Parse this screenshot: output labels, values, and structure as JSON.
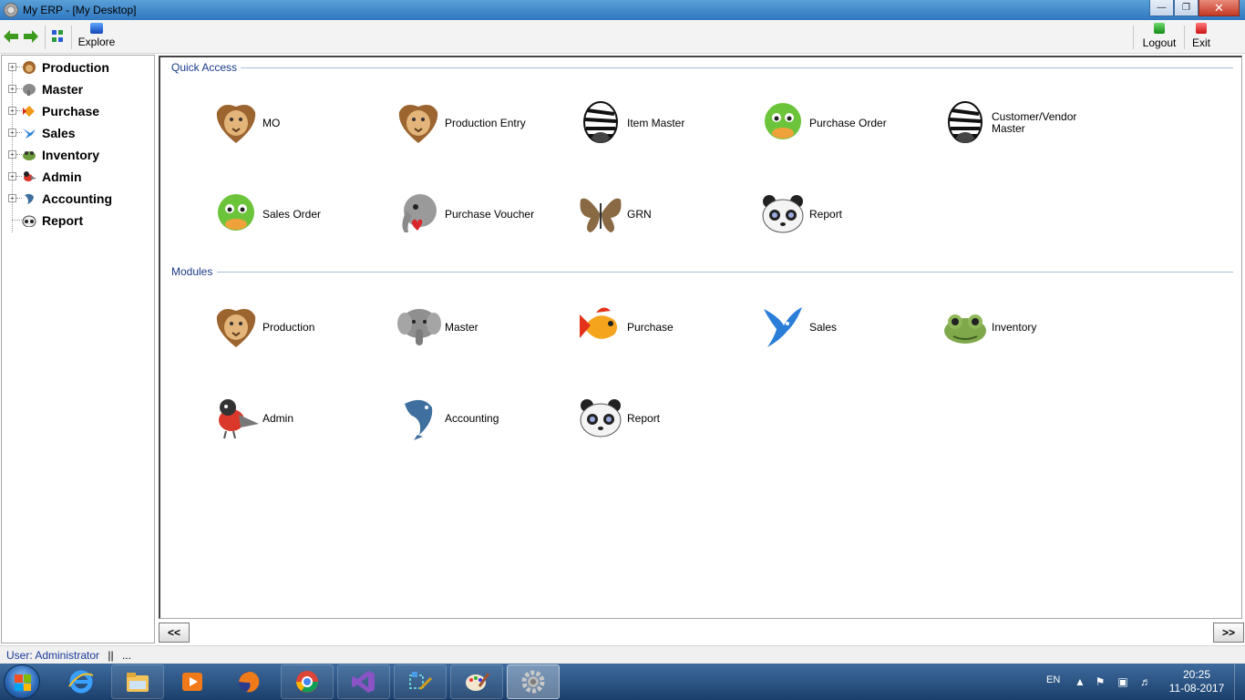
{
  "window": {
    "title": "My ERP - [My Desktop]"
  },
  "toolbar": {
    "explore_label": "Explore",
    "logout_label": "Logout",
    "exit_label": "Exit"
  },
  "sidebar": {
    "items": [
      {
        "label": "Production",
        "icon": "lion-icon"
      },
      {
        "label": "Master",
        "icon": "elephant-icon"
      },
      {
        "label": "Purchase",
        "icon": "fish-icon"
      },
      {
        "label": "Sales",
        "icon": "bird-icon"
      },
      {
        "label": "Inventory",
        "icon": "frog-icon"
      },
      {
        "label": "Admin",
        "icon": "bullfinch-icon"
      },
      {
        "label": "Accounting",
        "icon": "dolphin-icon"
      },
      {
        "label": "Report",
        "icon": "panda-icon"
      }
    ]
  },
  "quick_access": {
    "title": "Quick Access",
    "tiles": [
      {
        "label": "MO",
        "icon": "lion-icon"
      },
      {
        "label": "Production Entry",
        "icon": "lion-icon"
      },
      {
        "label": "Item Master",
        "icon": "zebra-icon"
      },
      {
        "label": "Purchase Order",
        "icon": "duck-icon"
      },
      {
        "label": "Customer/Vendor Master",
        "icon": "zebra-icon"
      },
      {
        "label": "Sales Order",
        "icon": "duck-icon"
      },
      {
        "label": "Purchase Voucher",
        "icon": "elephant-heart-icon"
      },
      {
        "label": "GRN",
        "icon": "butterfly-icon"
      },
      {
        "label": "Report",
        "icon": "panda-icon"
      }
    ]
  },
  "modules": {
    "title": "Modules",
    "tiles": [
      {
        "label": "Production",
        "icon": "lion-icon"
      },
      {
        "label": "Master",
        "icon": "elephant-icon"
      },
      {
        "label": "Purchase",
        "icon": "fish-icon"
      },
      {
        "label": "Sales",
        "icon": "bird-icon"
      },
      {
        "label": "Inventory",
        "icon": "frog-icon"
      },
      {
        "label": "Admin",
        "icon": "bullfinch-icon"
      },
      {
        "label": "Accounting",
        "icon": "dolphin-icon"
      },
      {
        "label": "Report",
        "icon": "panda-icon"
      }
    ]
  },
  "nav": {
    "prev_label": "<<",
    "next_label": ">>"
  },
  "status": {
    "user": "User: Administrator",
    "separator": "||",
    "extra": "..."
  },
  "taskbar": {
    "apps": [
      "internet-explorer-icon",
      "file-explorer-icon",
      "media-player-icon",
      "firefox-icon",
      "chrome-icon",
      "visual-studio-icon",
      "tools-icon",
      "paint-icon",
      "erp-gear-icon"
    ],
    "language": "EN",
    "time": "20:25",
    "date": "11-08-2017"
  }
}
